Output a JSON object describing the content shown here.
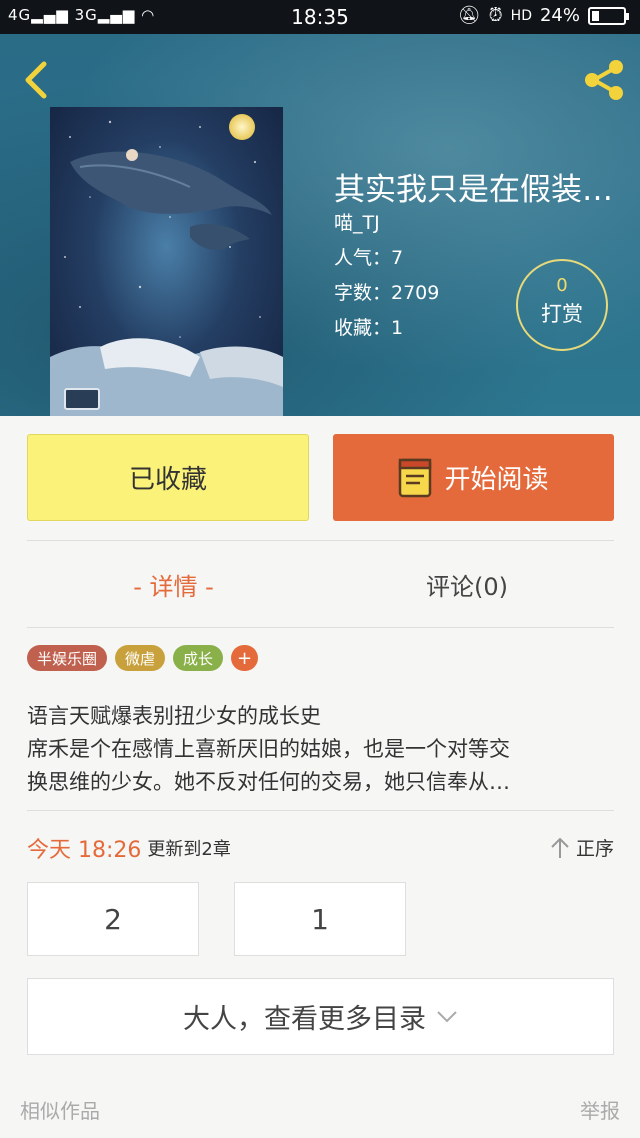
{
  "status_bar": {
    "signal_left": "4G",
    "signal_right": "3G",
    "time": "18:35",
    "battery_percent": "24%",
    "battery_level": 0.24
  },
  "book": {
    "title": "其实我只是在假装…",
    "author": "喵_TJ",
    "popularity": "人气：7",
    "word_count": "字数：2709",
    "favorites": "收藏：1",
    "reward_count": "0",
    "reward_label": "打赏"
  },
  "actions": {
    "collected_label": "已收藏",
    "read_label": "开始阅读"
  },
  "tabs": {
    "detail": "- 详情 -",
    "comments": "评论(0)"
  },
  "tags": [
    {
      "label": "半娱乐圈",
      "color": "#c0614f"
    },
    {
      "label": "微虐",
      "color": "#c9a13c"
    },
    {
      "label": "成长",
      "color": "#8ab04a"
    }
  ],
  "tag_add": "+",
  "synopsis": {
    "line1": "语言天赋爆表别扭少女的成长史",
    "line2": "席禾是个在感情上喜新厌旧的姑娘，也是一个对等交",
    "line3": "换思维的少女。她不反对任何的交易，她只信奉从…"
  },
  "update": {
    "today": "今天 18:26",
    "info": "更新到2章",
    "sort_label": "正序"
  },
  "chapters": [
    "2",
    "1"
  ],
  "more_catalog": "大人，查看更多目录",
  "footer": {
    "similar": "相似作品",
    "report": "举报"
  },
  "colors": {
    "accent": "#e56a3b",
    "collected_bg": "#fbf27a",
    "header_bg": "#2c6f8a"
  }
}
